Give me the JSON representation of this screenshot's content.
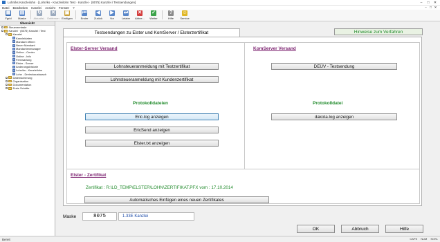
{
  "window": {
    "title": "Lohn/ks Kanzleilohn · [Lohn/ks - Kanzleilohn Test · Kanzlei · (8075) Kanzlei / Testsendungen]",
    "controls": [
      "–",
      "□",
      "✕"
    ]
  },
  "menu": [
    "Datei",
    "Bearbeiten",
    "Kanzlei",
    "Ansicht",
    "Fenster",
    "?"
  ],
  "mdi_controls": [
    "–",
    "□",
    "✕"
  ],
  "toolbar": [
    {
      "label": "Fgrid",
      "icon": "grid-icon",
      "color": "#3b6fb6",
      "glyph": "▦",
      "disabled": false
    },
    {
      "label": "Maske",
      "icon": "mask-icon",
      "color": "#5a87c9",
      "glyph": "▤",
      "disabled": false
    },
    {
      "label": "Aktualisi..",
      "icon": "refresh-icon",
      "color": "#9aa9bd",
      "glyph": "↻",
      "disabled": true
    },
    {
      "label": "Entfernen",
      "icon": "remove-icon",
      "color": "#9aa9bd",
      "glyph": "✕",
      "disabled": true
    },
    {
      "label": "Einfügen",
      "icon": "paste-icon",
      "color": "#c9a13b",
      "glyph": "▣",
      "disabled": false
    },
    {
      "label": "Erster",
      "icon": "first-icon",
      "color": "#5a87c9",
      "glyph": "⏮",
      "disabled": false
    },
    {
      "label": "Zurück",
      "icon": "back-icon",
      "color": "#5a87c9",
      "glyph": "◀",
      "disabled": false
    },
    {
      "label": "Vor",
      "icon": "forward-icon",
      "color": "#5a87c9",
      "glyph": "▶",
      "disabled": false
    },
    {
      "label": "Letzter",
      "icon": "last-icon",
      "color": "#5a87c9",
      "glyph": "⏭",
      "disabled": false
    },
    {
      "label": "Abbre...",
      "icon": "cancel-icon",
      "color": "#d43c3c",
      "glyph": "✕",
      "disabled": false
    },
    {
      "label": "Weiter",
      "icon": "next-icon",
      "color": "#3ca34a",
      "glyph": "✓",
      "disabled": false
    },
    {
      "label": "Hilfe",
      "icon": "help-icon",
      "color": "#8a8a8a",
      "glyph": "?",
      "disabled": false
    },
    {
      "label": "Service",
      "icon": "service-icon",
      "color": "#e0b726",
      "glyph": "☺",
      "disabled": false
    }
  ],
  "tree": {
    "header": "Übersicht",
    "items": [
      {
        "label": "Steuerzentrale",
        "type": "fold",
        "level": 0,
        "expander": "+"
      },
      {
        "label": "Kanzlei · (8075) Kanzlei / Test",
        "type": "fold",
        "level": 0,
        "expander": "–"
      },
      {
        "label": "Kanzlei",
        "type": "fold",
        "level": 1,
        "expander": "–"
      },
      {
        "label": "Kanzleidaten",
        "type": "doc",
        "level": 2,
        "expander": ""
      },
      {
        "label": "Mandant öffnen",
        "type": "doc",
        "level": 2,
        "expander": ""
      },
      {
        "label": "Neuer Mandant",
        "type": "doc",
        "level": 2,
        "expander": ""
      },
      {
        "label": "Mandantenmanager",
        "type": "doc",
        "level": 2,
        "expander": ""
      },
      {
        "label": "Online - Center",
        "type": "doc",
        "level": 2,
        "expander": ""
      },
      {
        "label": "Online - Info",
        "type": "doc",
        "level": 2,
        "expander": ""
      },
      {
        "label": "Fernwartung",
        "type": "doc",
        "level": 2,
        "expander": ""
      },
      {
        "label": "Elster - Server",
        "type": "doc",
        "level": 2,
        "expander": ""
      },
      {
        "label": "Änderungshistorie",
        "type": "doc",
        "level": 2,
        "expander": ""
      },
      {
        "label": "Lohn/ks - Kanzleilohn",
        "type": "doc",
        "level": 2,
        "expander": ""
      },
      {
        "label": "Lohn - Dreieckaustausch",
        "type": "doc",
        "level": 2,
        "expander": ""
      },
      {
        "label": "Datensicherung",
        "type": "fold",
        "level": 1,
        "expander": "+"
      },
      {
        "label": "Organisation",
        "type": "fold",
        "level": 1,
        "expander": "+"
      },
      {
        "label": "Dokumentation",
        "type": "fold",
        "level": 1,
        "expander": "+"
      },
      {
        "label": "Erste Schritte",
        "type": "fold",
        "level": 1,
        "expander": "+"
      }
    ]
  },
  "tab": {
    "label": "Testsendungen zu Elster und KomServer   /   Elsterzertifikat"
  },
  "hinweise_label": "Hinweise zum Verfahren",
  "elster": {
    "title": "Elster-Server Versand",
    "btn_testzertifikat": "Lohnsteueranmeldung mit Testzertifikat",
    "btn_kundenzertifikat": "Lohnsteueranmeldung mit Kundenzertifikat",
    "protokoll_title": "Protokolldateien",
    "btn_ericlog": "Eric.log anzeigen",
    "btn_ericsend": "EricSend anzeigen",
    "btn_elstertxt": "Elster.txt anzeigen"
  },
  "komserver": {
    "title": "KomServer Versand",
    "btn_deuev": "DEÜV - Testsendung",
    "protokoll_title": "Protokolldatei",
    "btn_dakota": "dakota.log anzeigen"
  },
  "zertifikat": {
    "title": "Elster - Zertifikat",
    "path_text": "Zertifikat : R:\\LD_TEMP\\ELSTER\\LOHN\\ZERTIFIKAT.PFX      vom : 17.10.2014",
    "btn_auto": "Automatisches Einfügen eines neuen Zertifikates"
  },
  "footer": {
    "maske_label": "Maske",
    "maske_value": "8075",
    "kanzlei_value": "1.33E Kanzlei",
    "ok": "OK",
    "abbruch": "Abbruch",
    "hilfe": "Hilfe"
  },
  "status": {
    "left": "Bereit",
    "right": [
      "CAPS",
      "NUM",
      "SCRL"
    ]
  }
}
